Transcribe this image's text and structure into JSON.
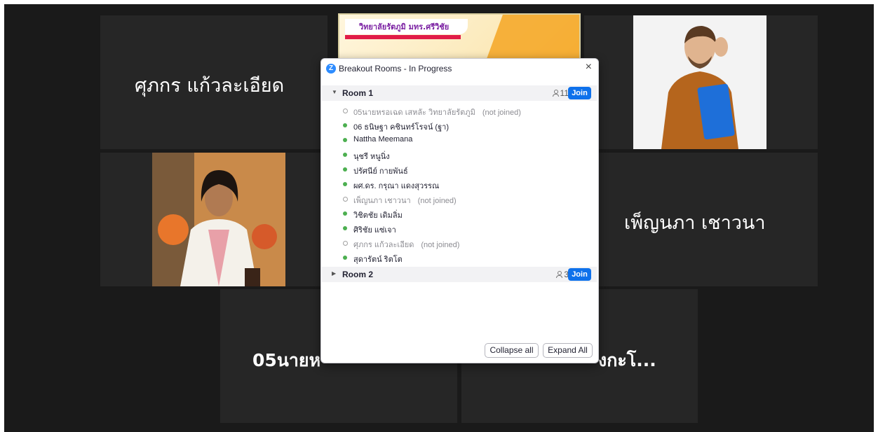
{
  "window": {
    "background": "#1a1a1a",
    "tile_color": "#262626"
  },
  "tiles": {
    "top_left_name": "ศุภกร  แก้วละเอียด",
    "mid_right_name": "เพ็ญนภา เชาวนา",
    "bottom_left_name": "05นายห",
    "bottom_right_name": "งกะโ..."
  },
  "banner": {
    "text": "วิทยาลัยรัตภูมิ มทร.ศรีวิชัย",
    "color": "#f5a623"
  },
  "breakout": {
    "title": "Breakout Rooms - In Progress",
    "close_icon": "×",
    "accent": "#0e71eb",
    "rooms": [
      {
        "name": "Room 1",
        "count": "11",
        "join_label": "Join",
        "expanded": true,
        "participants": [
          {
            "name": "05นายหรอเฉด เสหลัะ วิทยาลัยรัตภูมิ",
            "status": "(not joined)",
            "joined": false
          },
          {
            "name": "06 ธนิษฐา คชินทร์โรจน์ (ฐา)",
            "status": "",
            "joined": true
          },
          {
            "name": "Nattha Meemana",
            "status": "",
            "joined": true
          },
          {
            "name": "นุชรี หนูนิ่ง",
            "status": "",
            "joined": true
          },
          {
            "name": "ปรัศนีย์ กายพันธ์",
            "status": "",
            "joined": true
          },
          {
            "name": "ผศ.ดร. กรุณา แดงสุวรรณ",
            "status": "",
            "joined": true
          },
          {
            "name": "เพ็ญนภา เชาวนา",
            "status": "(not joined)",
            "joined": false
          },
          {
            "name": "วิชิตชัย เดิมลิ่ม",
            "status": "",
            "joined": true
          },
          {
            "name": "ศิริชัย แซ่เจา",
            "status": "",
            "joined": true
          },
          {
            "name": "ศุภกร แก้วละเอียด",
            "status": "(not joined)",
            "joined": false
          },
          {
            "name": "สุดารัตน์ ริตโต",
            "status": "",
            "joined": true
          }
        ]
      },
      {
        "name": "Room 2",
        "count": "3",
        "join_label": "Join",
        "expanded": false
      }
    ],
    "collapse_label": "Collapse all",
    "expand_label": "Expand All"
  }
}
